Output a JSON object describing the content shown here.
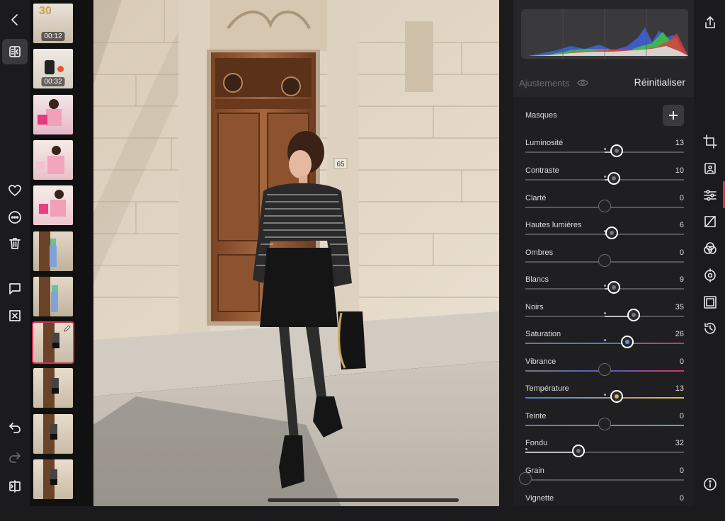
{
  "filmstrip": {
    "items": [
      {
        "duration": "00:12"
      },
      {
        "duration": "00:32"
      },
      {
        "duration": ""
      },
      {
        "duration": ""
      },
      {
        "duration": ""
      },
      {
        "duration": ""
      },
      {
        "duration": ""
      },
      {
        "duration": ""
      },
      {
        "duration": ""
      },
      {
        "duration": ""
      },
      {
        "duration": ""
      }
    ],
    "selected_index": 7
  },
  "photo": {
    "house_number": "65",
    "banner_number": "30"
  },
  "panel": {
    "adjustments_label": "Ajustements",
    "reset_label": "Réinitialiser",
    "masks_label": "Masques"
  },
  "sliders": [
    {
      "label": "Luminosité",
      "value": "13"
    },
    {
      "label": "Contraste",
      "value": "10"
    },
    {
      "label": "Clarté",
      "value": "0"
    },
    {
      "label": "Hautes lumières",
      "value": "6"
    },
    {
      "label": "Ombres",
      "value": "0"
    },
    {
      "label": "Blancs",
      "value": "9"
    },
    {
      "label": "Noirs",
      "value": "35"
    },
    {
      "label": "Saturation",
      "value": "26"
    },
    {
      "label": "Vibrance",
      "value": "0"
    },
    {
      "label": "Température",
      "value": "13"
    },
    {
      "label": "Teinte",
      "value": "0"
    },
    {
      "label": "Fondu",
      "value": "32"
    },
    {
      "label": "Grain",
      "value": "0"
    },
    {
      "label": "Vignette",
      "value": "0"
    }
  ],
  "colors": {
    "accent": "#d0334f",
    "panel_bg": "#1f1f21"
  },
  "icons": {
    "left": [
      "back-icon",
      "compare-icon",
      "heart-icon",
      "more-icon",
      "trash-icon",
      "comment-icon",
      "reject-icon",
      "undo-icon",
      "redo-icon",
      "split-view-icon"
    ],
    "right": [
      "share-icon",
      "crop-icon",
      "presets-icon",
      "adjust-icon",
      "curves-icon",
      "color-mixer-icon",
      "selective-icon",
      "frame-icon",
      "history-icon",
      "info-icon"
    ]
  }
}
